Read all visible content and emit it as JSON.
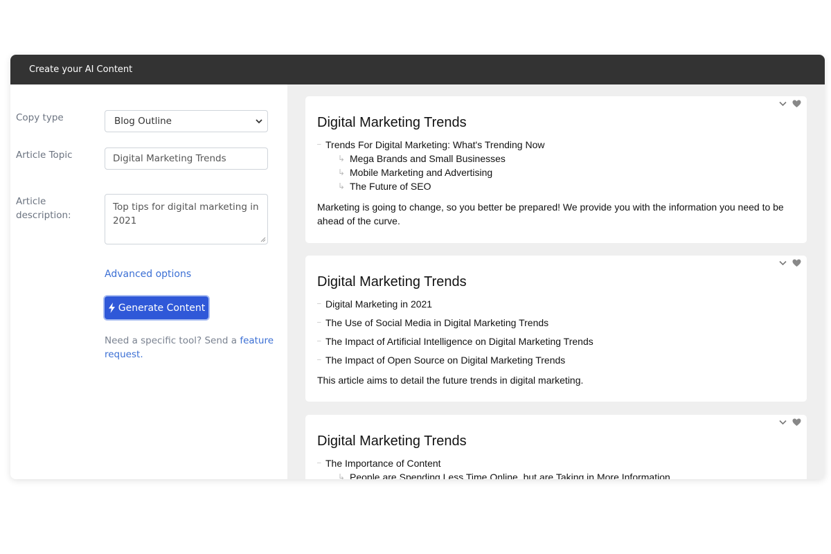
{
  "window": {
    "title": "Create your AI Content"
  },
  "form": {
    "copy_type_label": "Copy type",
    "copy_type_value": "Blog Outline",
    "topic_label": "Article Topic",
    "topic_value": "Digital Marketing Trends",
    "description_label_line1": "Article",
    "description_label_line2": "description:",
    "description_value": "Top tips for digital marketing in 2021",
    "advanced_label": "Advanced options",
    "generate_label": "Generate Content",
    "help_text": "Need a specific tool? Send a ",
    "help_link": "feature request."
  },
  "results": [
    {
      "title": "Digital Marketing Trends",
      "items": [
        {
          "text": "Trends For Digital Marketing: What's Trending Now",
          "subs": [
            "Mega Brands and Small Businesses",
            "Mobile Marketing and Advertising",
            "The Future of SEO"
          ]
        }
      ],
      "description": "Marketing is going to change, so you better be prepared! We provide you with the information you need to be ahead of the curve."
    },
    {
      "title": "Digital Marketing Trends",
      "items": [
        {
          "text": "Digital Marketing in 2021",
          "subs": []
        },
        {
          "text": "The Use of Social Media in Digital Marketing Trends",
          "subs": []
        },
        {
          "text": "The Impact of Artificial Intelligence on Digital Marketing Trends",
          "subs": []
        },
        {
          "text": "The Impact of Open Source on Digital Marketing Trends",
          "subs": []
        }
      ],
      "description": "This article aims to detail the future trends in digital marketing."
    },
    {
      "title": "Digital Marketing Trends",
      "items": [
        {
          "text": "The Importance of Content",
          "subs": [
            "People are Spending Less Time Online, but are Taking in More Information"
          ]
        }
      ],
      "description": ""
    }
  ],
  "colors": {
    "titlebar": "#333333",
    "accent": "#2f58d8",
    "link": "#3b6fd4"
  },
  "icons": [
    "chevron-down-icon",
    "heart-icon",
    "bolt-icon"
  ]
}
